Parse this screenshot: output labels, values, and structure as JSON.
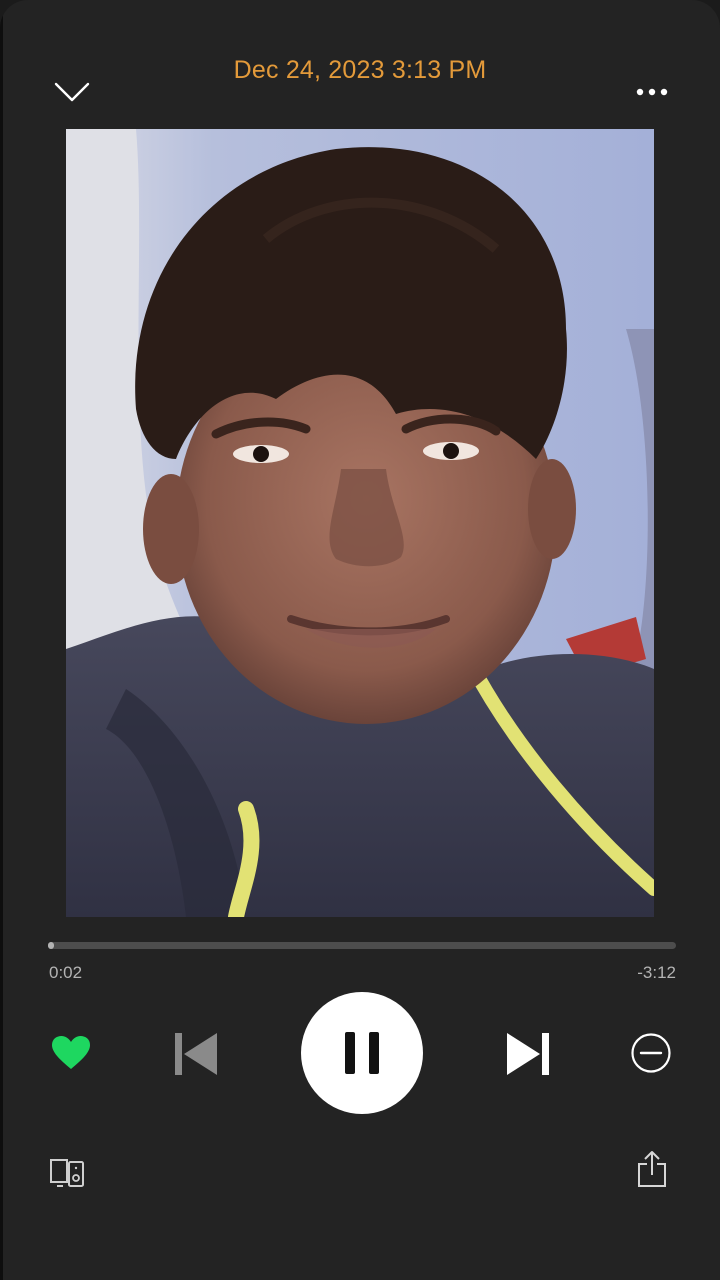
{
  "header": {
    "title": "Dec 24, 2023 3:13 PM",
    "collapse_icon": "chevron-down-icon",
    "more_icon": "more-dots-icon"
  },
  "artwork": {
    "description_icon": "photo-artwork"
  },
  "playback": {
    "elapsed": "0:02",
    "remaining": "-3:12",
    "progress_fraction": 0.01
  },
  "controls": {
    "liked": true,
    "heart_icon": "heart-filled-icon",
    "previous_icon": "skip-previous-icon",
    "play_pause_icon": "pause-icon",
    "next_icon": "skip-next-icon",
    "hide_icon": "minus-circle-icon",
    "devices_icon": "connect-devices-icon",
    "share_icon": "share-icon"
  },
  "colors": {
    "accent_title": "#e39a3a",
    "heart": "#1ed760",
    "background": "#232323"
  }
}
